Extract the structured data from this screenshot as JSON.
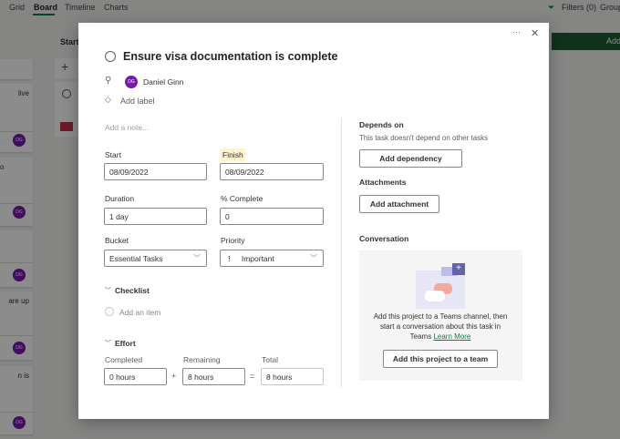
{
  "nav": {
    "tabs": [
      "Grid",
      "Board",
      "Timeline",
      "Charts"
    ],
    "active": "Board",
    "filters": "Filters (0)",
    "group": "Group"
  },
  "board": {
    "column_title": "Start",
    "add_button": "Add",
    "card_snippets": [
      "live",
      "o",
      "",
      "are up",
      "n is"
    ],
    "avatar": "DG"
  },
  "task": {
    "title": "Ensure visa documentation is complete",
    "assignee": {
      "initials": "DG",
      "name": "Daniel Ginn"
    },
    "add_label": "Add label",
    "note_placeholder": "Add a note...",
    "start_label": "Start",
    "start_value": "08/09/2022",
    "finish_label": "Finish",
    "finish_value": "08/09/2022",
    "duration_label": "Duration",
    "duration_value": "1 day",
    "complete_label": "% Complete",
    "complete_value": "0",
    "bucket_label": "Bucket",
    "bucket_value": "Essential Tasks",
    "priority_label": "Priority",
    "priority_value": "Important",
    "checklist_label": "Checklist",
    "add_item": "Add an item",
    "effort_label": "Effort",
    "completed_label": "Completed",
    "completed_value": "0 hours",
    "remaining_label": "Remaining",
    "remaining_value": "8 hours",
    "total_label": "Total",
    "total_value": "8 hours",
    "plus": "+",
    "equals": "=",
    "more": "···",
    "close": "✕",
    "depends_label": "Depends on",
    "depends_text": "This task doesn't depend on other tasks",
    "add_dependency": "Add dependency",
    "attachments_label": "Attachments",
    "add_attachment": "Add attachment",
    "conversation_label": "Conversation",
    "conversation_text": "Add this project to a Teams channel, then start a conversation about this task in Teams",
    "learn_more": "Learn More",
    "add_to_team": "Add this project to a team"
  },
  "colors": {
    "accent": "#107c41",
    "avatar": "#7719aa",
    "priority": "#d13438",
    "finish_highlight": "#fff4ce"
  }
}
